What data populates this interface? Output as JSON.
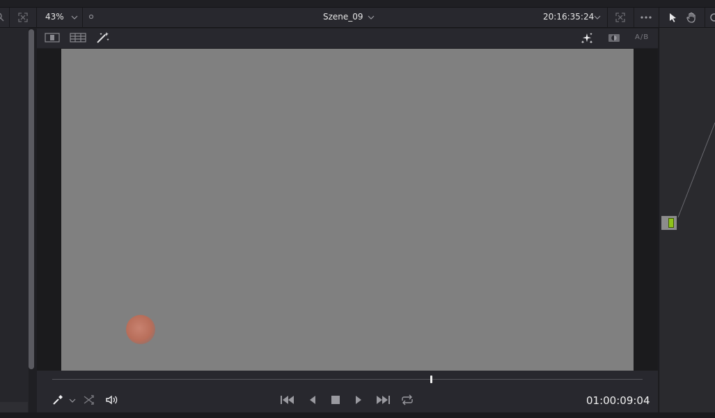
{
  "top_bar": {
    "zoom": "43%",
    "scene": "Szene_09",
    "timecode": "20:16:35:24"
  },
  "viewer_toolbar": {
    "ab_label": "A/B"
  },
  "transport": {
    "timecode": "01:00:09:04",
    "scrub_position": 0.642
  },
  "icons": {
    "top_left": [
      "search-icon",
      "fit-icon"
    ],
    "top_right": [
      "fullscreen-icon",
      "more-icon",
      "pointer-icon",
      "hand-icon"
    ],
    "viewer_left": [
      "single-view-icon",
      "grid-view-icon",
      "magic-wand-icon"
    ],
    "viewer_right": [
      "sparkle-icon",
      "mask-icon"
    ],
    "transport_left": [
      "eyedropper-icon",
      "shuffle-icon",
      "speaker-icon"
    ],
    "transport_center": [
      "skip-start-icon",
      "play-reverse-icon",
      "stop-icon",
      "play-icon",
      "skip-end-icon",
      "loop-icon"
    ]
  },
  "colors": {
    "node_accent": "#8ec21a",
    "canvas": "#808080"
  }
}
